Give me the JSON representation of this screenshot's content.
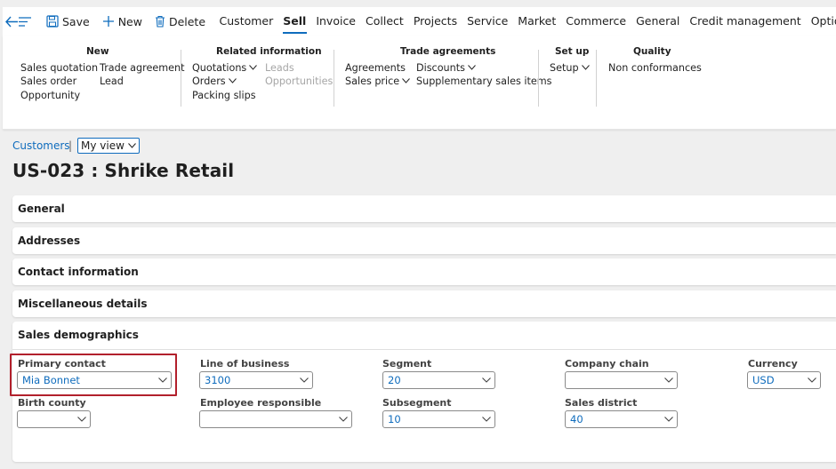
{
  "toolbar": {
    "back_icon": "back-arrow-icon",
    "menu_icon": "hamburger-icon",
    "save_label": "Save",
    "new_label": "New",
    "delete_label": "Delete",
    "tabs": [
      "Customer",
      "Sell",
      "Invoice",
      "Collect",
      "Projects",
      "Service",
      "Market",
      "Commerce",
      "General",
      "Credit management",
      "Options"
    ],
    "active_tab": "Sell",
    "search_icon": "search-icon"
  },
  "ribbon": {
    "groups": [
      {
        "title": "New",
        "items": [
          "Sales quotation",
          "Sales order",
          "Opportunity",
          "Trade agreement",
          "Lead"
        ]
      },
      {
        "title": "Related information",
        "items": [
          "Quotations",
          "Orders",
          "Packing slips",
          "Leads",
          "Opportunities"
        ]
      },
      {
        "title": "Trade agreements",
        "items": [
          "Agreements",
          "Sales price",
          "Discounts",
          "Supplementary sales items"
        ]
      },
      {
        "title": "Set up",
        "items": [
          "Setup"
        ]
      },
      {
        "title": "Quality",
        "items": [
          "Non conformances"
        ]
      }
    ]
  },
  "breadcrumb": {
    "link": "Customers",
    "separator": "|",
    "view": "My view"
  },
  "page_title": "US-023 : Shrike Retail",
  "fasttabs": [
    "General",
    "Addresses",
    "Contact information",
    "Miscellaneous details",
    "Sales demographics"
  ],
  "demographics": {
    "primary_contact": {
      "label": "Primary contact",
      "value": "Mia Bonnet"
    },
    "line_of_business": {
      "label": "Line of business",
      "value": "3100"
    },
    "segment": {
      "label": "Segment",
      "value": "20"
    },
    "company_chain": {
      "label": "Company chain",
      "value": ""
    },
    "currency": {
      "label": "Currency",
      "value": "USD"
    },
    "birth_county": {
      "label": "Birth county",
      "value": ""
    },
    "employee_responsible": {
      "label": "Employee responsible",
      "value": ""
    },
    "subsegment": {
      "label": "Subsegment",
      "value": "10"
    },
    "sales_district": {
      "label": "Sales district",
      "value": "40"
    }
  },
  "colors": {
    "accent": "#0f6cbd",
    "highlight": "#b2202c"
  }
}
